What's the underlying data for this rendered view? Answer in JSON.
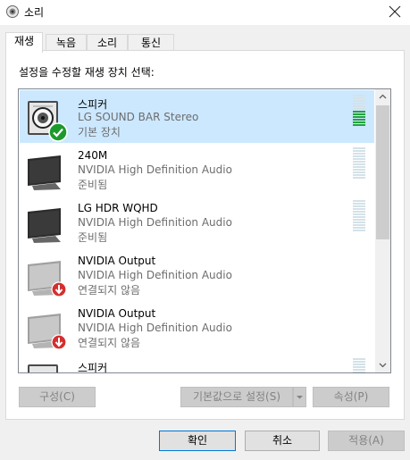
{
  "window": {
    "title": "소리"
  },
  "tabs": [
    {
      "label": "재생"
    },
    {
      "label": "녹음"
    },
    {
      "label": "소리"
    },
    {
      "label": "통신"
    }
  ],
  "prompt": "설정을 수정할 재생 장치 선택:",
  "devices": [
    {
      "name": "스피커",
      "description": "LG SOUND BAR Stereo",
      "status": "기본 장치",
      "icon": "speaker-icon",
      "badge": "default-check-icon",
      "level_bars_lit": 6
    },
    {
      "name": "240M",
      "description": "NVIDIA High Definition Audio",
      "status": "준비됨",
      "icon": "monitor-icon",
      "level_bars_lit": 0
    },
    {
      "name": "LG HDR WQHD",
      "description": "NVIDIA High Definition Audio",
      "status": "준비됨",
      "icon": "monitor-icon",
      "level_bars_lit": 0
    },
    {
      "name": "NVIDIA Output",
      "description": "NVIDIA High Definition Audio",
      "status": "연결되지 않음",
      "icon": "monitor-disconnected-icon",
      "badge": "disconnected-arrow-icon"
    },
    {
      "name": "NVIDIA Output",
      "description": "NVIDIA High Definition Audio",
      "status": "연결되지 않음",
      "icon": "monitor-disconnected-icon",
      "badge": "disconnected-arrow-icon"
    },
    {
      "name": "스피커",
      "icon": "speaker-icon"
    }
  ],
  "buttons": {
    "configure": "구성(C)",
    "set_default": "기본값으로 설정(S)",
    "properties": "속성(P)",
    "ok": "확인",
    "cancel": "취소",
    "apply": "적용(A)"
  },
  "colors": {
    "selection": "#cce8ff",
    "meter_on": "#24a23e",
    "meter_off": "#d4e2e8",
    "check": "#1d9a2e",
    "disconnected": "#d32f2f"
  }
}
